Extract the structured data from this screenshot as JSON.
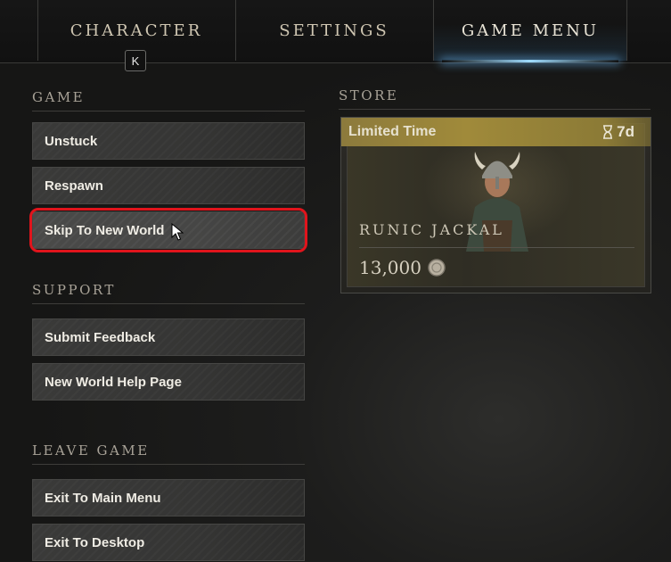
{
  "nav": {
    "tabs": [
      {
        "label": "CHARACTER",
        "active": false
      },
      {
        "label": "SETTINGS",
        "active": false
      },
      {
        "label": "GAME MENU",
        "active": true
      }
    ],
    "keyhint": "K"
  },
  "sections": {
    "game": {
      "title": "GAME",
      "buttons": [
        "Unstuck",
        "Respawn",
        "Skip To New World"
      ]
    },
    "support": {
      "title": "SUPPORT",
      "buttons": [
        "Submit Feedback",
        "New World Help Page"
      ]
    },
    "leave": {
      "title": "LEAVE GAME",
      "buttons": [
        "Exit To Main Menu",
        "Exit To Desktop"
      ]
    }
  },
  "store": {
    "title": "STORE",
    "card": {
      "banner": "Limited Time",
      "timer": "7d",
      "item_name": "RUNIC JACKAL",
      "price": "13,000"
    }
  },
  "colors": {
    "accent_glow": "#9fdcff",
    "highlight": "#e0141c",
    "banner": "#a08a3a"
  }
}
